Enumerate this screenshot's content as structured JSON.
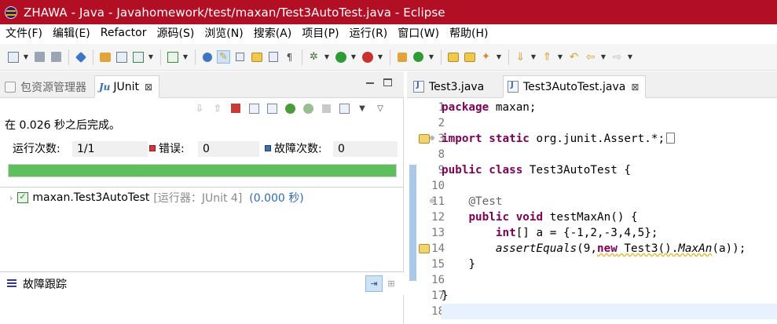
{
  "window": {
    "title": "ZHAWA  -  Java  -  Javahomework/test/maxan/Test3AutoTest.java  -  Eclipse"
  },
  "menu": [
    {
      "label": "文件(F)"
    },
    {
      "label": "编辑(E)"
    },
    {
      "label": "Refactor"
    },
    {
      "label": "源码(S)"
    },
    {
      "label": "浏览(N)"
    },
    {
      "label": "搜索(A)"
    },
    {
      "label": "项目(P)"
    },
    {
      "label": "运行(R)"
    },
    {
      "label": "窗口(W)"
    },
    {
      "label": "帮助(H)"
    }
  ],
  "left_tabs": {
    "package_explorer": "包资源管理器",
    "junit": "JUnit",
    "close_glyph": "⊠"
  },
  "junit": {
    "finished_text": "在 0.026 秒之后完成。",
    "runs_label": "运行次数:",
    "runs_value": "1/1",
    "errors_label": "错误:",
    "errors_value": "0",
    "failures_label": "故障次数:",
    "failures_value": "0",
    "progress_fraction": 1.0,
    "progress_color": "#5fbf5f",
    "tree": {
      "suite_name": "maxan.Test3AutoTest",
      "runner": "[运行器：JUnit 4]",
      "duration": "(0.000 秒)"
    },
    "trace_title": "故障跟踪"
  },
  "editor": {
    "tabs": [
      {
        "label": "Test3.java"
      },
      {
        "label": "Test3AutoTest.java",
        "close_glyph": "⊠"
      }
    ],
    "line_numbers": [
      "1",
      "2",
      "3",
      "8",
      "9",
      "10",
      "11",
      "12",
      "13",
      "14",
      "15",
      "16",
      "17",
      "18"
    ],
    "code": {
      "l1_kw": "package",
      "l1_rest": " maxan;",
      "l3_kw1": "import",
      "l3_kw2": "static",
      "l3_rest": " org.junit.Assert.*;",
      "l9_kw1": "public",
      "l9_kw2": "class",
      "l9_rest": " Test3AutoTest {",
      "l11_ann": "@Test",
      "l12_kw1": "public",
      "l12_kw2": "void",
      "l12_rest": " testMaxAn() {",
      "l13_kw": "int",
      "l13_rest": "[] a = {-1,2,-3,4,5};",
      "l14_method": "assertEquals",
      "l14_a": "(9,",
      "l14_new": "new",
      "l14_b": " Test3().",
      "l14_call": "MaxAn",
      "l14_c": "(a));",
      "l15_brace": "}",
      "l17_brace": "}"
    }
  },
  "icons": {
    "app": "eclipse-icon",
    "junit": "junit-icon",
    "java_file": "java-file-icon",
    "suite": "test-suite-passed-icon",
    "warning": "warning-marker-icon"
  }
}
